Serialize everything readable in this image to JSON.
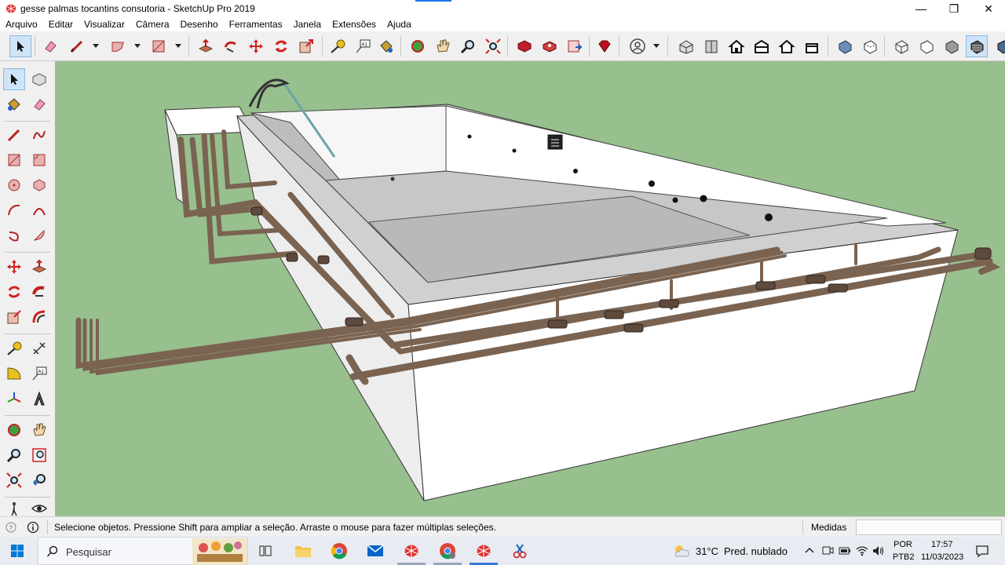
{
  "window": {
    "title": "gesse palmas tocantins consutoria - SketchUp Pro 2019",
    "minimize_glyph": "—",
    "maximize_glyph": "❐",
    "close_glyph": "✕"
  },
  "menu": [
    "Arquivo",
    "Editar",
    "Visualizar",
    "Câmera",
    "Desenho",
    "Ferramentas",
    "Janela",
    "Extensões",
    "Ajuda"
  ],
  "toolbar_icons": [
    "select-icon",
    "eraser-icon",
    "line-icon",
    "arc-icon",
    "rectangle-icon",
    "push-pull-icon",
    "follow-me-icon",
    "move-icon",
    "rotate-icon",
    "scale-icon",
    "tape-measure-icon",
    "text-icon",
    "paint-bucket-icon",
    "orbit-icon",
    "pan-icon",
    "zoom-icon",
    "zoom-extents-icon",
    "3d-warehouse-icon",
    "extension-warehouse-icon",
    "layout-icon",
    "ruby-icon",
    "user-icon",
    "iso-view-icon",
    "top-view-icon",
    "front-view-icon",
    "right-view-icon",
    "back-view-icon",
    "left-view-icon",
    "xray-icon",
    "back-edges-icon",
    "wireframe-icon",
    "hidden-line-icon",
    "shaded-icon",
    "shaded-textures-icon",
    "monochrome-icon"
  ],
  "status": {
    "message": "Selecione objetos. Pressione Shift para ampliar a seleção. Arraste o mouse para fazer múltiplas seleções.",
    "measures_label": "Medidas",
    "measures_value": ""
  },
  "taskbar": {
    "search_placeholder": "Pesquisar",
    "weather_temp": "31°C",
    "weather_desc": "Pred. nublado",
    "lang_line1": "POR",
    "lang_line2": "PTB2",
    "time": "17:57",
    "date": "11/03/2023"
  },
  "colors": {
    "viewport_bg": "#98bf8e",
    "pool_wall": "#ffffff",
    "pool_floor": "#c8c8c8",
    "pipe": "#7a6351",
    "accent": "#1a73e8"
  }
}
